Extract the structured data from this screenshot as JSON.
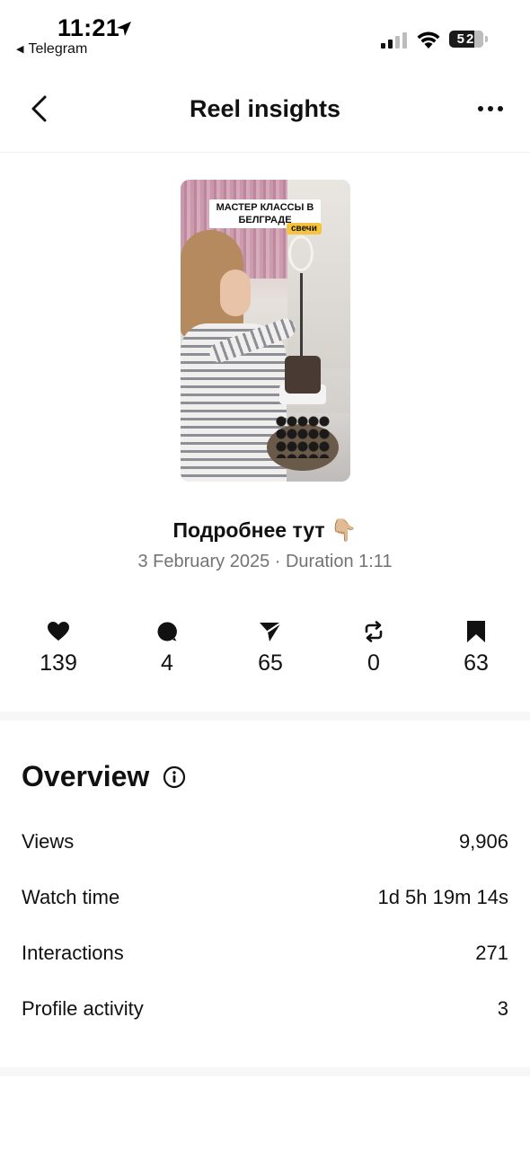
{
  "status_bar": {
    "time": "11:21",
    "back_app": "Telegram",
    "battery_level": "52",
    "icons": [
      "location-arrow-icon",
      "cellular-signal-icon",
      "wifi-icon",
      "battery-icon"
    ]
  },
  "header": {
    "title": "Reel insights",
    "icons": [
      "chevron-left-icon",
      "more-horizontal-icon"
    ]
  },
  "reel": {
    "thumbnail_caption": "МАСТЕР КЛАССЫ В БЕЛГРАДЕ",
    "thumbnail_tag": "свечи",
    "caption": "Подробнее тут",
    "caption_emoji": "👇🏼",
    "meta": "3 February 2025 · Duration 1:11"
  },
  "stats": [
    {
      "icon": "heart-icon",
      "value": "139"
    },
    {
      "icon": "comment-icon",
      "value": "4"
    },
    {
      "icon": "send-icon",
      "value": "65"
    },
    {
      "icon": "repost-icon",
      "value": "0"
    },
    {
      "icon": "bookmark-icon",
      "value": "63"
    }
  ],
  "overview": {
    "title": "Overview",
    "rows": [
      {
        "label": "Views",
        "value": "9,906"
      },
      {
        "label": "Watch time",
        "value": "1d 5h 19m 14s"
      },
      {
        "label": "Interactions",
        "value": "271"
      },
      {
        "label": "Profile activity",
        "value": "3"
      }
    ]
  },
  "colors": {
    "text": "#111111",
    "secondary_text": "#737373",
    "divider": "#f7f7f7",
    "tag": "#f6c33c"
  }
}
